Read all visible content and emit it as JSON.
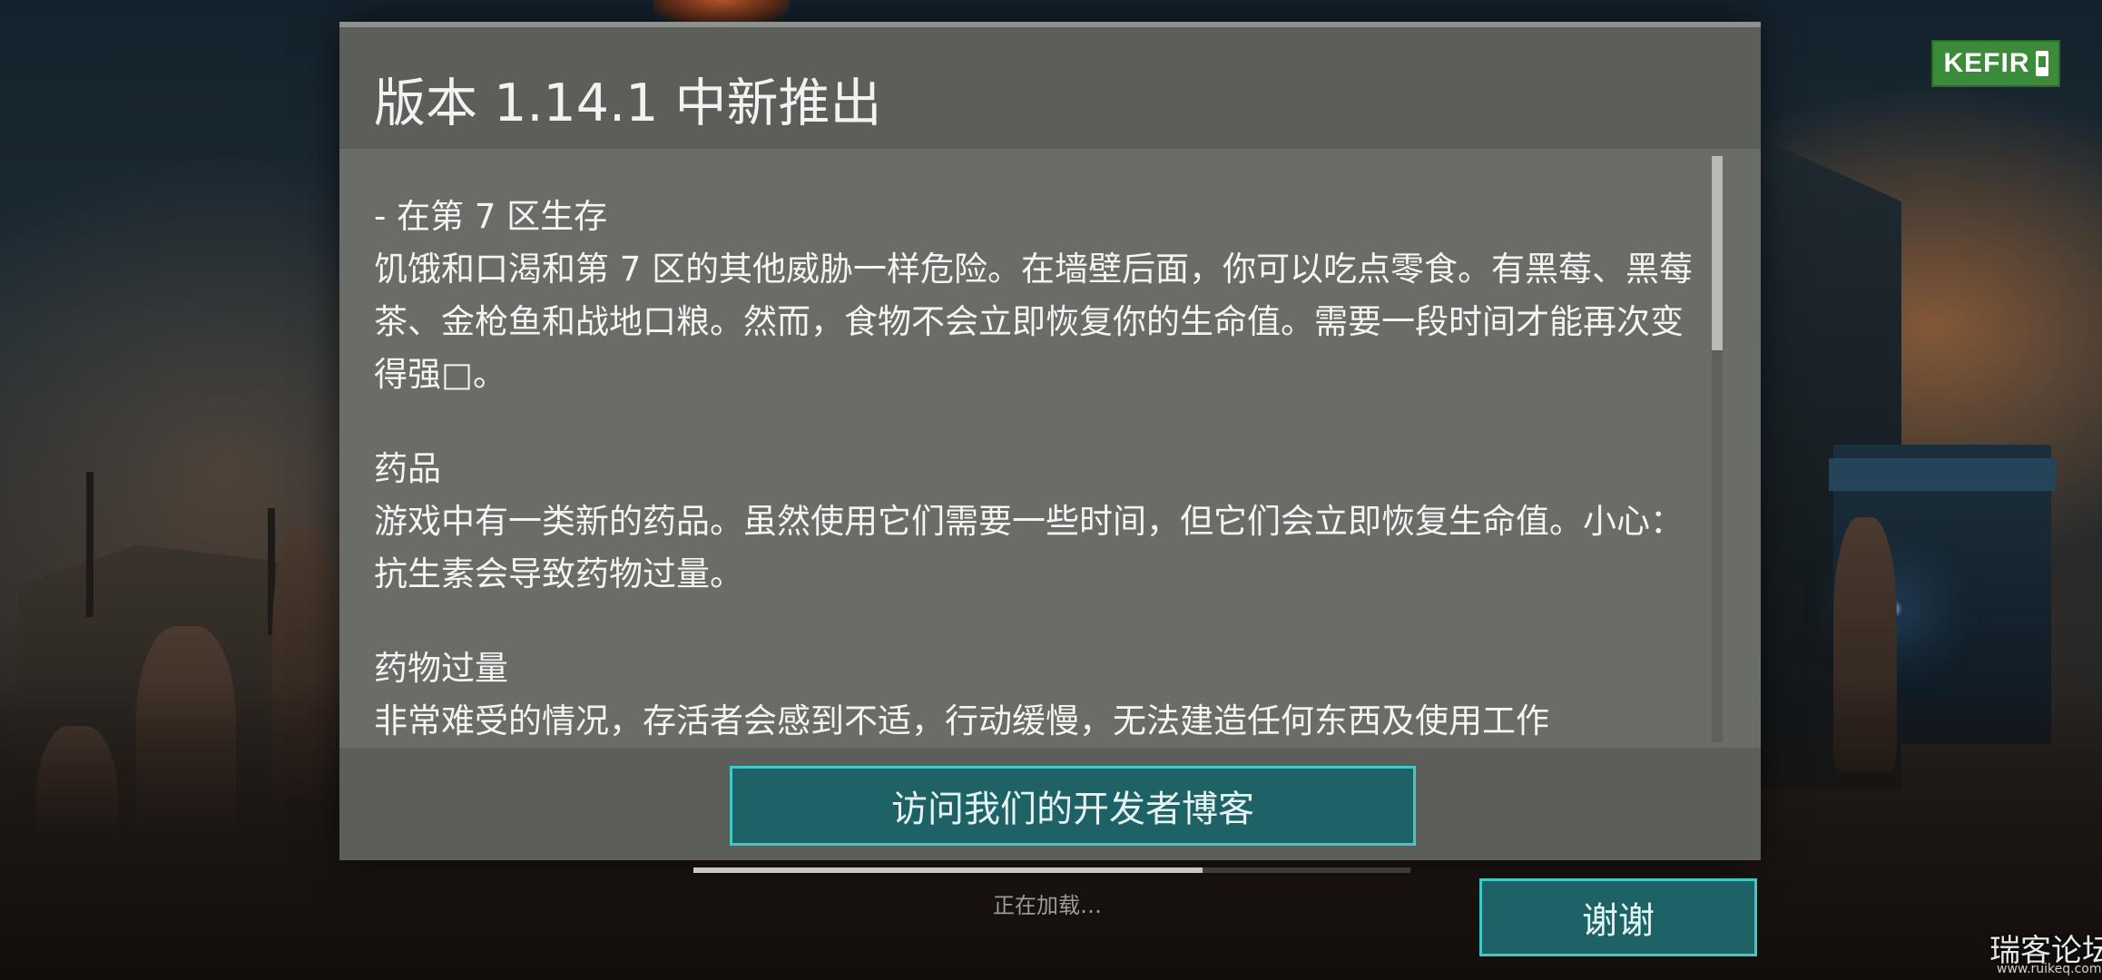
{
  "dialog": {
    "title": "版本 1.14.1 中新推出",
    "sections": [
      {
        "title": "- 在第 7 区生存",
        "body": "饥饿和口渴和第 7 区的其他威胁一样危险。在墙壁后面，你可以吃点零食。有黑莓、黑莓茶、金枪鱼和战地口粮。然而，食物不会立即恢复你的生命值。需要一段时间才能再次变得强□。"
      },
      {
        "title": "药品",
        "body": "游戏中有一类新的药品。虽然使用它们需要一些时间，但它们会立即恢复生命值。小心：抗生素会导致药物过量。"
      },
      {
        "title": "药物过量",
        "body": "非常难受的情况，存活者会感到不适，行动缓慢，无法建造任何东西及使用工作"
      }
    ],
    "blog_button_label": "访问我们的开发者博客",
    "scroll_position": 0.0
  },
  "loading": {
    "text": "正在加载…",
    "progress": 0.71
  },
  "thanks_button_label": "谢谢",
  "logo": {
    "text": "KEFIR",
    "icon": "bottle-icon",
    "color": "#3b8b3a"
  },
  "watermark": {
    "text": "瑞客论坛",
    "url": "www.ruikeq.com"
  },
  "colors": {
    "dialog_bg": "#6a6c68",
    "header_bg": "#5c5e5a",
    "button_bg": "#1f6266",
    "button_border": "#42c8c6"
  }
}
